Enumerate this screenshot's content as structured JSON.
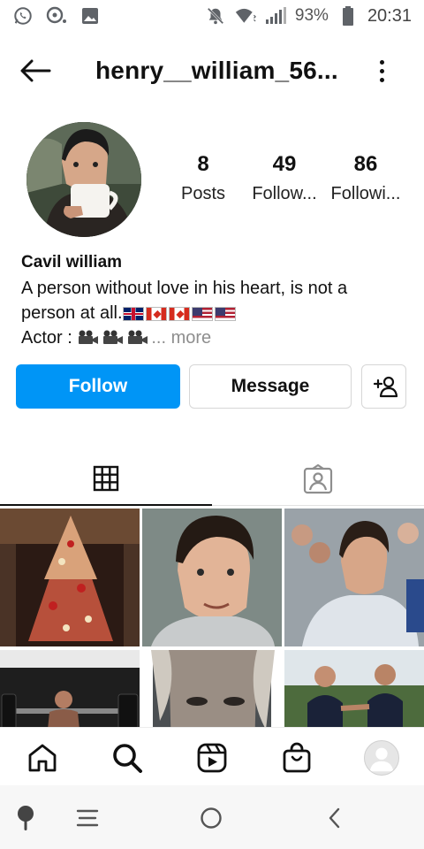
{
  "status_bar": {
    "left_icons": [
      "whatsapp-icon",
      "chat-bubble-icon",
      "gallery-icon"
    ],
    "right_icons": [
      "mute-icon",
      "wifi-icon",
      "signal-icon",
      "battery-icon"
    ],
    "battery_percent": "93%",
    "time": "20:31"
  },
  "header": {
    "username": "henry__william_56..."
  },
  "profile": {
    "stats": [
      {
        "value": "8",
        "label": "Posts"
      },
      {
        "value": "49",
        "label": "Follow..."
      },
      {
        "value": "86",
        "label": "Followi..."
      }
    ],
    "display_name": "Cavil william",
    "bio_line1": "A person without love in his heart, is not a",
    "bio_line2": "person at all.",
    "bio_line2_flags": [
      "uk",
      "ca",
      "ca",
      "us",
      "us"
    ],
    "bio_line3_prefix": "Actor : ",
    "bio_line3_more": "... more"
  },
  "actions": {
    "follow_label": "Follow",
    "message_label": "Message"
  },
  "tabs": [
    {
      "name": "grid-tab",
      "icon": "grid-icon",
      "active": true
    },
    {
      "name": "tagged-tab",
      "icon": "tagged-person-icon",
      "active": false
    }
  ],
  "posts": [
    {
      "subject": "christmas-tree"
    },
    {
      "subject": "portrait-smiling"
    },
    {
      "subject": "man-in-crowd"
    },
    {
      "subject": "barbell-workout"
    },
    {
      "subject": "close-up-face"
    },
    {
      "subject": "two-men-outdoors"
    }
  ],
  "bottom_nav": [
    "home-icon",
    "search-icon",
    "reels-icon",
    "shop-icon",
    "profile-avatar"
  ],
  "system_nav": [
    "assistant-icon",
    "recents-icon",
    "home-circle-icon",
    "back-chevron-icon"
  ],
  "colors": {
    "accent": "#0095f6",
    "text": "#111111",
    "muted": "#8e8e8e"
  }
}
